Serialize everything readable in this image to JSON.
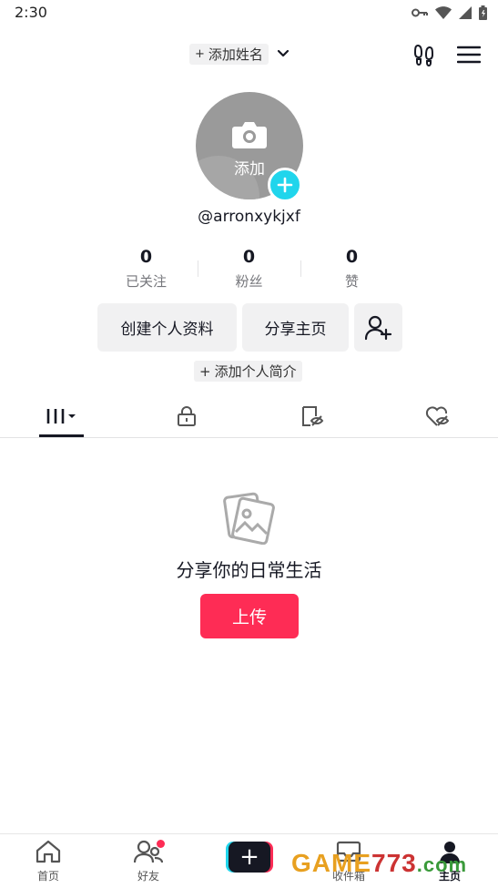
{
  "status_bar": {
    "time": "2:30"
  },
  "top_bar": {
    "add_name_label": "添加姓名"
  },
  "profile": {
    "avatar_label": "添加",
    "username": "@arronxykjxf"
  },
  "stats": [
    {
      "value": "0",
      "label": "已关注"
    },
    {
      "value": "0",
      "label": "粉丝"
    },
    {
      "value": "0",
      "label": "赞"
    }
  ],
  "actions": {
    "edit_profile": "创建个人资料",
    "share_profile": "分享主页"
  },
  "add_bio_label": "添加个人简介",
  "tabs": [
    {
      "icon": "grid-icon",
      "active": true
    },
    {
      "icon": "lock-icon",
      "active": false
    },
    {
      "icon": "tag-hidden-icon",
      "active": false
    },
    {
      "icon": "heart-hidden-icon",
      "active": false
    }
  ],
  "empty_state": {
    "message": "分享你的日常生活",
    "upload_button": "上传"
  },
  "bottom_nav": {
    "home": "首页",
    "friends": "好友",
    "inbox": "收件箱",
    "profile": "主页"
  },
  "watermark": {
    "part1": "GAME",
    "part2": "773",
    "part3": ".com"
  },
  "colors": {
    "accent": "#fe2c55",
    "cyan": "#20d5ec",
    "text": "#161823",
    "muted": "#75767b"
  }
}
